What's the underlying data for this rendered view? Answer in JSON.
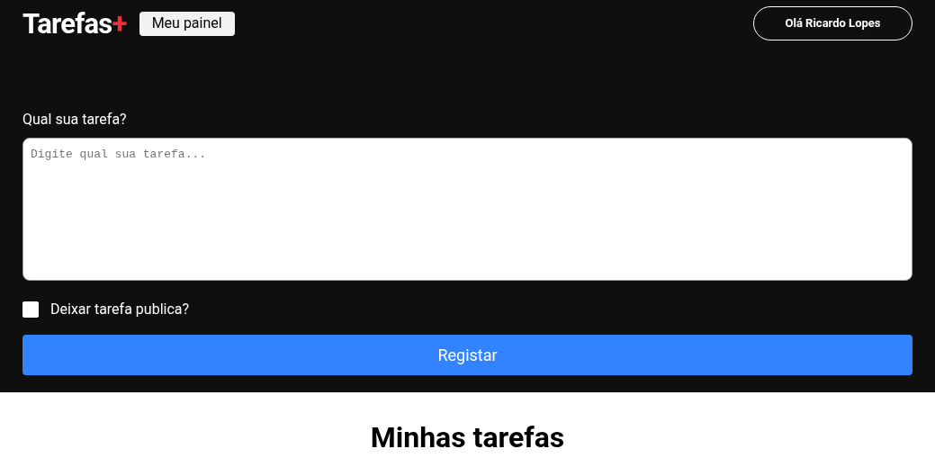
{
  "header": {
    "logo": {
      "text": "Tarefas",
      "accent": "+"
    },
    "dashboard_button": "Meu painel",
    "user_button": "Olá Ricardo Lopes"
  },
  "form": {
    "label": "Qual sua tarefa?",
    "textarea": {
      "placeholder": "Digite qual sua tarefa..."
    },
    "public_checkbox": {
      "label": "Deixar tarefa publica?",
      "checked": false
    },
    "submit": "Registar"
  },
  "tasks": {
    "title": "Minhas tarefas"
  }
}
